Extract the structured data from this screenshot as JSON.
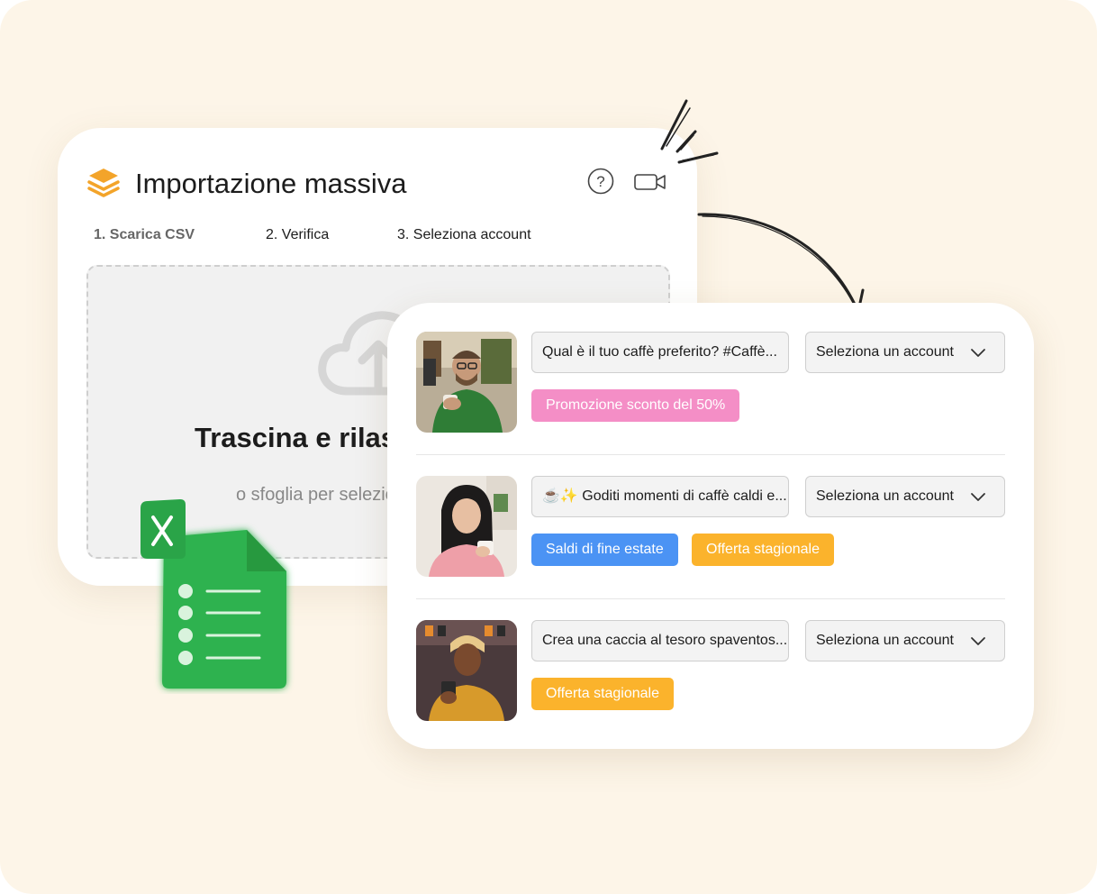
{
  "import_card": {
    "title": "Importazione massiva",
    "steps": [
      "1. Scarica CSV",
      "2. Verifica",
      "3. Seleziona account"
    ],
    "drop_title": "Trascina e rilascia il tuo file qui",
    "drop_subtitle": "o sfoglia per selezionare un file",
    "icons": {
      "logo": "layers-icon",
      "help": "help-icon",
      "video": "video-camera-icon",
      "upload": "cloud-upload-icon"
    }
  },
  "posts": [
    {
      "caption": "Qual è il tuo caffè preferito? #Caffè...",
      "account_placeholder": "Seleziona un account",
      "tags": [
        {
          "label": "Promozione sconto del 50%",
          "color": "#f48ec6"
        }
      ]
    },
    {
      "caption": "☕✨ Goditi momenti di caffè caldi e...",
      "account_placeholder": "Seleziona un account",
      "tags": [
        {
          "label": "Saldi di fine estate",
          "color": "#4b93f4"
        },
        {
          "label": "Offerta stagionale",
          "color": "#fbb32c"
        }
      ]
    },
    {
      "caption": "Crea una caccia al tesoro spaventos...",
      "account_placeholder": "Seleziona un account",
      "tags": [
        {
          "label": "Offerta stagionale",
          "color": "#fbb32c"
        }
      ]
    }
  ],
  "colors": {
    "background": "#fdf5e8",
    "accent": "#f3a42a",
    "sheet_green": "#2fb24f"
  }
}
